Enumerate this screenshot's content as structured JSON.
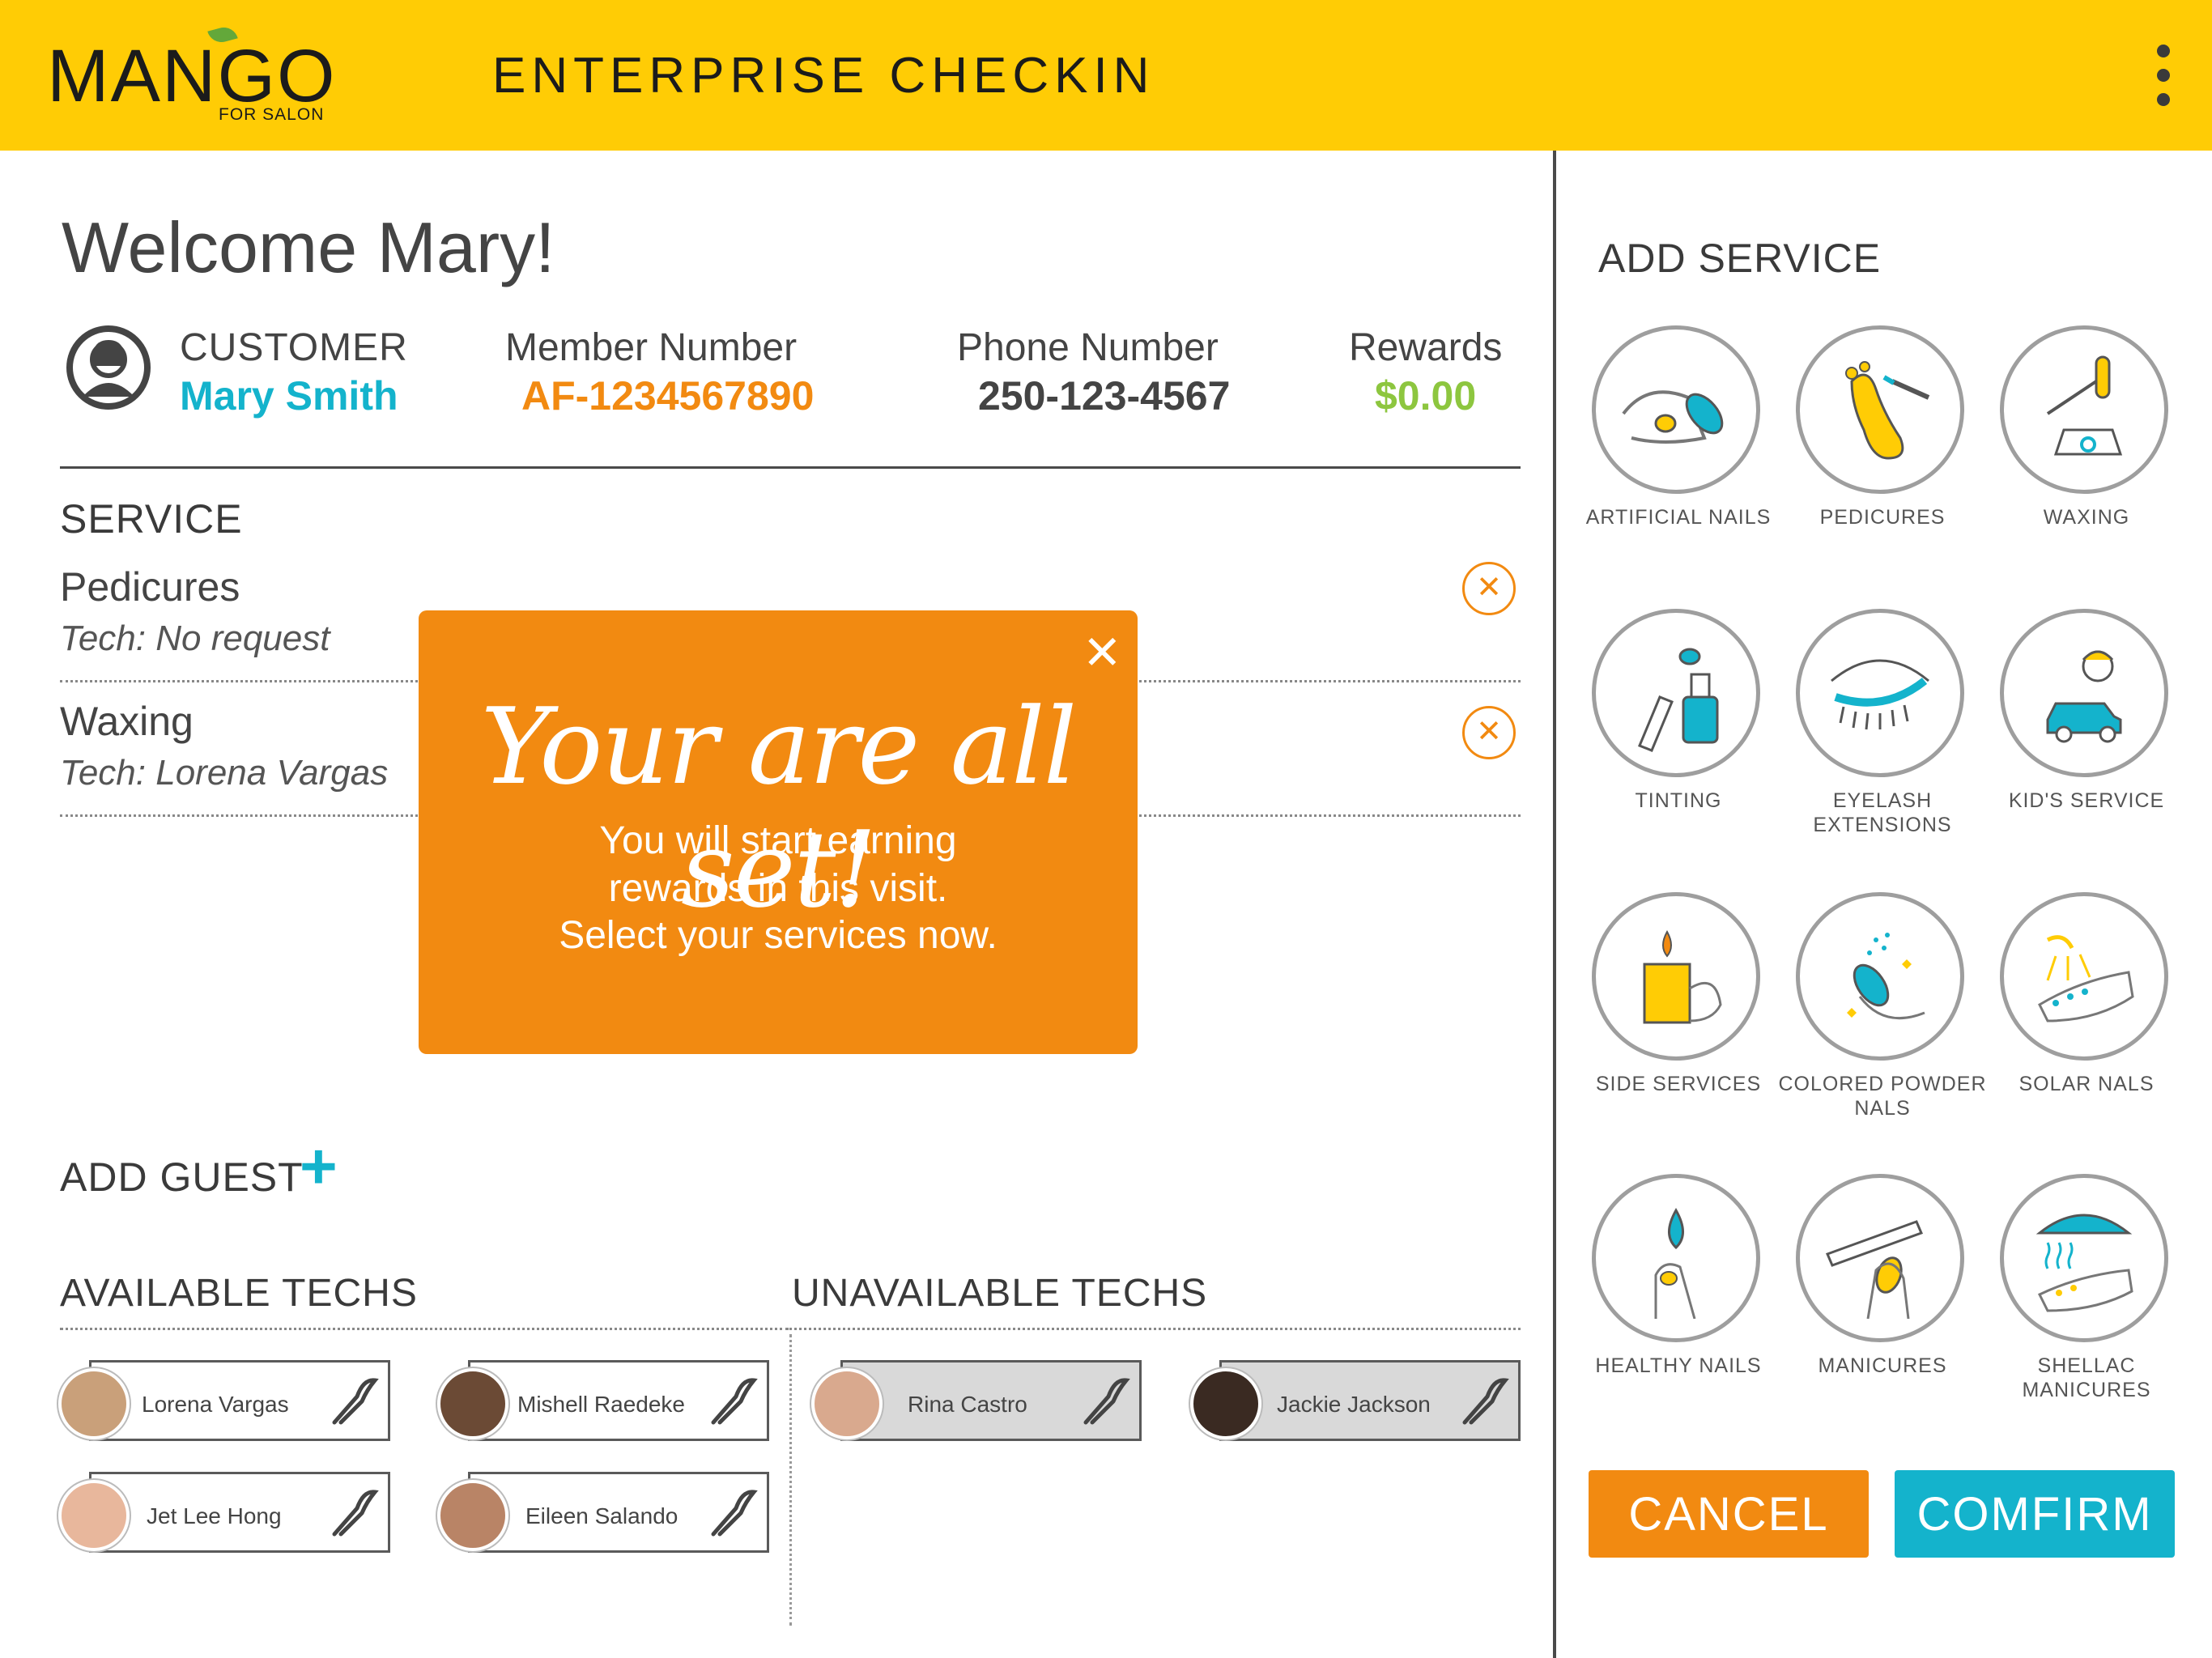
{
  "header": {
    "logo_text": "MANGO",
    "logo_sub": "FOR SALON",
    "title": "ENTERPRISE CHECKIN"
  },
  "welcome": "Welcome Mary!",
  "customer": {
    "label": "CUSTOMER",
    "name": "Mary Smith",
    "member_label": "Member Number",
    "member_number": "AF-1234567890",
    "phone_label": "Phone Number",
    "phone": "250-123-4567",
    "rewards_label": "Rewards",
    "rewards": "$0.00"
  },
  "service": {
    "heading": "SERVICE",
    "items": [
      {
        "name": "Pedicures",
        "tech": "Tech: No request"
      },
      {
        "name": "Waxing",
        "tech": "Tech: Lorena Vargas"
      }
    ]
  },
  "add_guest": "ADD GUEST",
  "available_techs": {
    "heading": "AVAILABLE TECHS",
    "items": [
      "Lorena Vargas",
      "Mishell Raedeke",
      "Jet Lee Hong",
      "Eileen Salando"
    ]
  },
  "unavailable_techs": {
    "heading": "UNAVAILABLE TECHS",
    "items": [
      "Rina Castro",
      "Jackie Jackson"
    ]
  },
  "add_service": {
    "heading": "ADD SERVICE",
    "items": [
      {
        "label": "ARTIFICIAL NAILS",
        "icon": "artificial-nails-icon"
      },
      {
        "label": "PEDICURES",
        "icon": "pedicures-icon"
      },
      {
        "label": "WAXING",
        "icon": "waxing-icon"
      },
      {
        "label": "TINTING",
        "icon": "tinting-icon"
      },
      {
        "label": "EYELASH EXTENSIONS",
        "icon": "eyelash-icon"
      },
      {
        "label": "KID'S SERVICE",
        "icon": "kids-service-icon"
      },
      {
        "label": "SIDE SERVICES",
        "icon": "side-services-icon"
      },
      {
        "label": "COLORED POWDER NALS",
        "icon": "powder-nails-icon"
      },
      {
        "label": "SOLAR NALS",
        "icon": "solar-nails-icon"
      },
      {
        "label": "HEALTHY NAILS",
        "icon": "healthy-nails-icon"
      },
      {
        "label": "MANICURES",
        "icon": "manicures-icon"
      },
      {
        "label": "SHELLAC MANICURES",
        "icon": "shellac-icon"
      }
    ]
  },
  "buttons": {
    "cancel": "CANCEL",
    "confirm": "COMFIRM"
  },
  "modal": {
    "title": "Your are all set!",
    "line1": "You will start earning",
    "line2": "rewards in this visit.",
    "line3": "Select your services now."
  },
  "colors": {
    "brand_yellow": "#ffcc05",
    "orange": "#f28a11",
    "teal": "#14b3cc",
    "green": "#8dc63f"
  }
}
